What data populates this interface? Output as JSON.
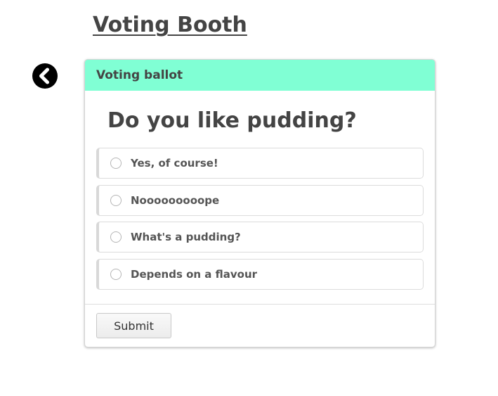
{
  "header": {
    "title": "Voting Booth"
  },
  "back_button": {
    "icon": "chevron-left-circle-icon"
  },
  "ballot": {
    "header": "Voting ballot",
    "question": "Do you like pudding?",
    "options": [
      {
        "label": "Yes, of course!",
        "selected": false
      },
      {
        "label": "Nooooooooope",
        "selected": false
      },
      {
        "label": "What's a pudding?",
        "selected": false
      },
      {
        "label": "Depends on a flavour",
        "selected": false
      }
    ],
    "submit_label": "Submit",
    "colors": {
      "header_bg": "#80ffd4",
      "text": "#444444"
    }
  }
}
